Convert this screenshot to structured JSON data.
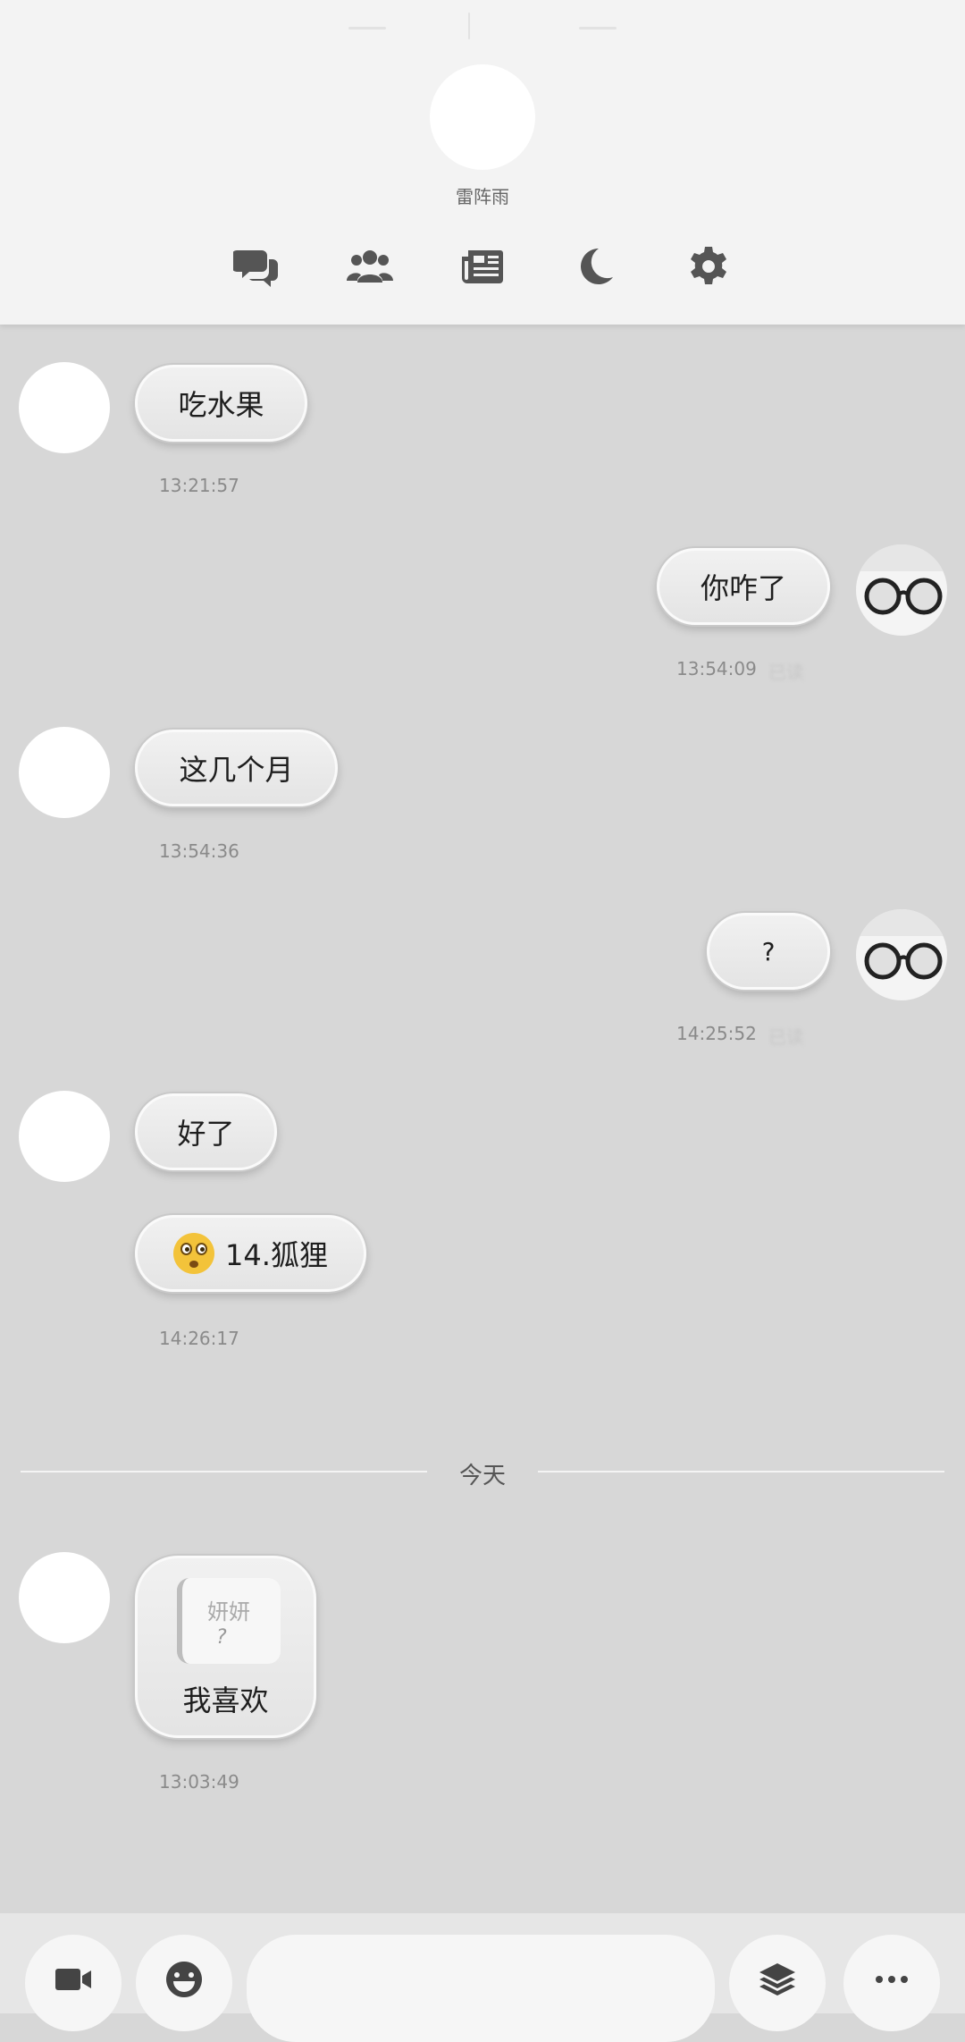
{
  "header": {
    "contact_name": "雷阵雨",
    "nav": [
      "chat-icon",
      "contacts-icon",
      "feed-icon",
      "dark-mode-icon",
      "settings-icon"
    ]
  },
  "messages": [
    {
      "from": "them",
      "text": "吃水果",
      "time": "13:21:57"
    },
    {
      "from": "me",
      "text": "你咋了",
      "time": "13:54:09",
      "status": "已读"
    },
    {
      "from": "them",
      "text": "这几个月",
      "time": "13:54:36"
    },
    {
      "from": "me",
      "text": "?",
      "time": "14:25:52",
      "status": "已读"
    },
    {
      "from": "them",
      "text": "好了",
      "time": ""
    },
    {
      "from": "them",
      "emoji": "flushed-face-emoji",
      "text": "14.狐狸",
      "time": "14:26:17"
    }
  ],
  "divider": {
    "label": "今天"
  },
  "quoted_message": {
    "from": "them",
    "quote_name": "妍妍",
    "quote_text": "?",
    "text": "我喜欢",
    "time": "13:03:49"
  },
  "bottom_bar": {
    "buttons": [
      "video-call-icon",
      "emoji-icon",
      "layers-icon",
      "more-icon"
    ],
    "input_value": ""
  }
}
